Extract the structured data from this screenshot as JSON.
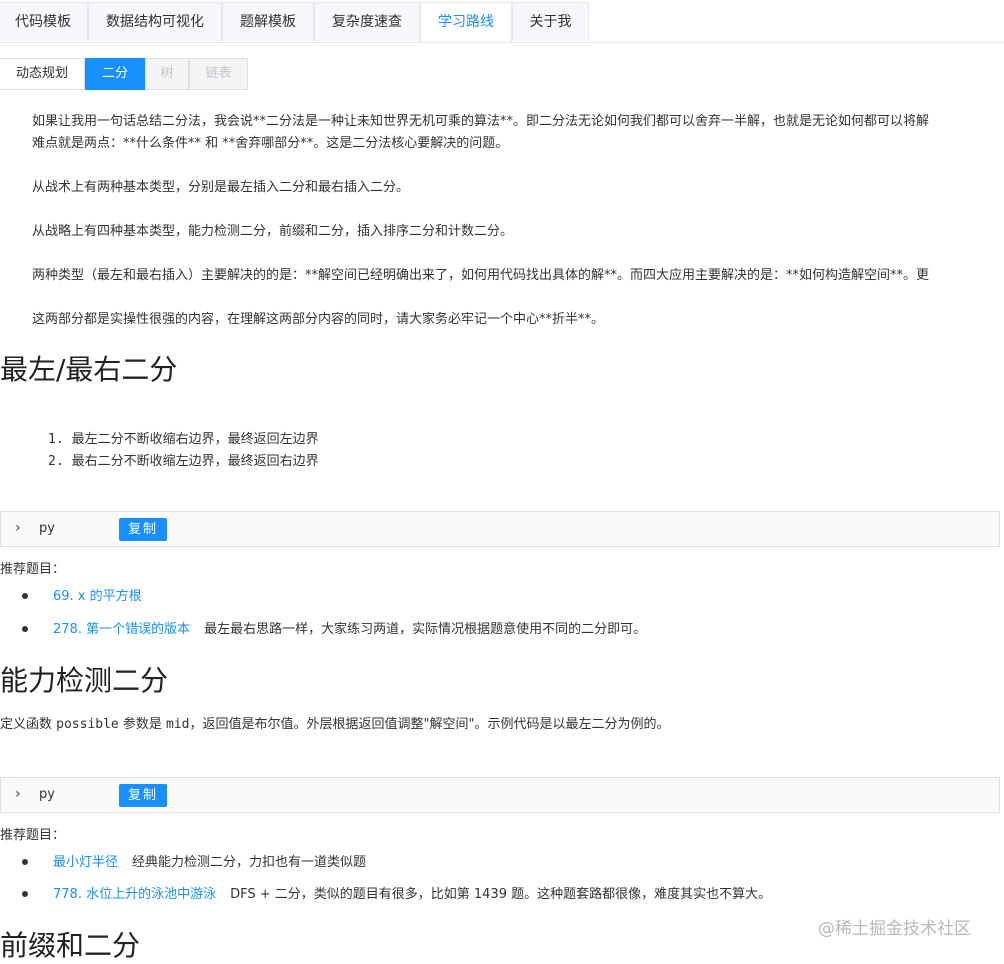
{
  "top_tabs": [
    "代码模板",
    "数据结构可视化",
    "题解模板",
    "复杂度速查",
    "学习路线",
    "关于我"
  ],
  "active_top_tab": "学习路线",
  "sub_tabs": [
    "动态规划",
    "二分",
    "树",
    "链表"
  ],
  "active_sub_tab": "二分",
  "intro": [
    "如果让我用一句话总结二分法，我会说**二分法是一种让未知世界无机可乘的算法**。即二分法无论如何我们都可以舍弃一半解，也就是无论如何都可以将解",
    "难点就是两点：**什么条件** 和 **舍弃哪部分**。这是二分法核心要解决的问题。",
    "从战术上有两种基本类型，分别是最左插入二分和最右插入二分。",
    "从战略上有四种基本类型，能力检测二分，前缀和二分，插入排序二分和计数二分。",
    "两种类型（最左和最右插入）主要解决的的是：**解空间已经明确出来了，如何用代码找出具体的解**。而四大应用主要解决的是：**如何构造解空间**。更",
    "这两部分都是实操性很强的内容，在理解这两部分内容的同时，请大家务必牢记一个中心**折半**。"
  ],
  "section1": {
    "title": "最左/最右二分",
    "list": [
      "最左二分不断收缩右边界，最终返回左边界",
      "最右二分不断收缩左边界，最终返回右边界"
    ],
    "code_lang": "py",
    "copy_label": "复制",
    "rec_label": "推荐题目：",
    "problems": [
      {
        "link": "69. x 的平方根",
        "desc": ""
      },
      {
        "link": "278. 第一个错误的版本",
        "desc": "最左最右思路一样，大家练习两道，实际情况根据题意使用不同的二分即可。"
      }
    ]
  },
  "section2": {
    "title": "能力检测二分",
    "desc_pre": "定义函数 ",
    "desc_code1": "possible",
    "desc_mid": " 参数是 ",
    "desc_code2": "mid",
    "desc_post": "，返回值是布尔值。外层根据返回值调整\"解空间\"。示例代码是以最左二分为例的。",
    "code_lang": "py",
    "copy_label": "复制",
    "rec_label": "推荐题目：",
    "problems": [
      {
        "link": "最小灯半径",
        "desc": "经典能力检测二分，力扣也有一道类似题"
      },
      {
        "link": "778. 水位上升的泳池中游泳",
        "desc": "DFS + 二分，类似的题目有很多，比如第 1439 题。这种题套路都很像，难度其实也不算大。"
      }
    ]
  },
  "section3": {
    "title": "前缀和二分"
  },
  "watermark": "@稀土掘金技术社区"
}
